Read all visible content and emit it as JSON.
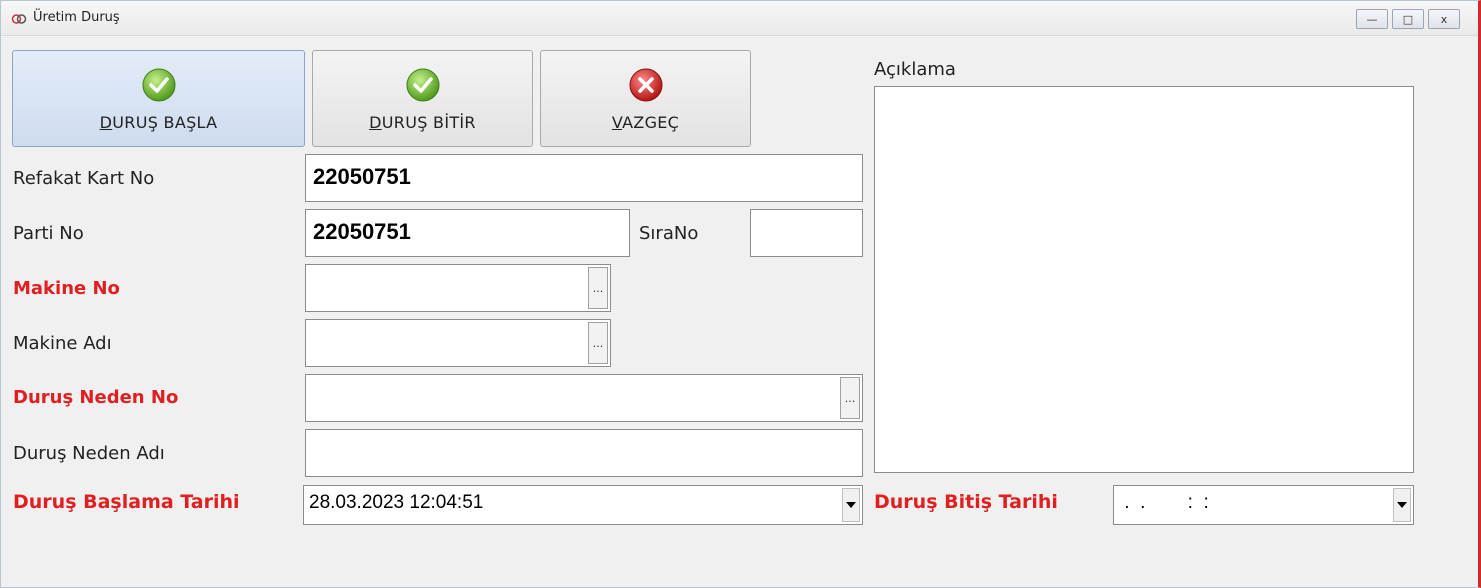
{
  "window": {
    "title": "Üretim Duruş",
    "minimize_glyph": "—",
    "maximize_glyph": "□",
    "close_glyph": "x"
  },
  "toolbar": {
    "start_label_first": "D",
    "start_label_rest": "URUŞ BAŞLA",
    "finish_label_first": "D",
    "finish_label_rest": "URUŞ BİTİR",
    "cancel_label_first": "V",
    "cancel_label_rest": "AZGEÇ"
  },
  "form": {
    "refakat_label": "Refakat Kart No",
    "refakat_value": "22050751",
    "parti_label": "Parti No",
    "parti_value": "22050751",
    "sirano_label": "SıraNo",
    "sirano_value": "",
    "makine_no_label": "Makine No",
    "makine_no_value": "",
    "makine_adi_label": "Makine Adı",
    "makine_adi_value": "",
    "durus_neden_no_label": "Duruş Neden No",
    "durus_neden_no_value": "",
    "durus_neden_adi_label": "Duruş Neden Adı",
    "durus_neden_adi_value": "",
    "baslama_label": "Duruş Başlama Tarihi",
    "baslama_value": "28.03.2023 12:04:51",
    "bitis_label": "Duruş Bitiş Tarihi",
    "bitis_value": " .  .        :  :",
    "aciklama_label": "Açıklama",
    "aciklama_value": "",
    "ellipsis_glyph": "..."
  },
  "colors": {
    "required_label": "#e02020",
    "check_green": "#6ab82b",
    "cancel_red": "#d62323",
    "window_accent": "#d12a2a"
  },
  "icons": {
    "app": "rings-icon",
    "start": "check-circle-icon",
    "finish": "check-circle-icon",
    "cancel": "x-circle-icon"
  }
}
